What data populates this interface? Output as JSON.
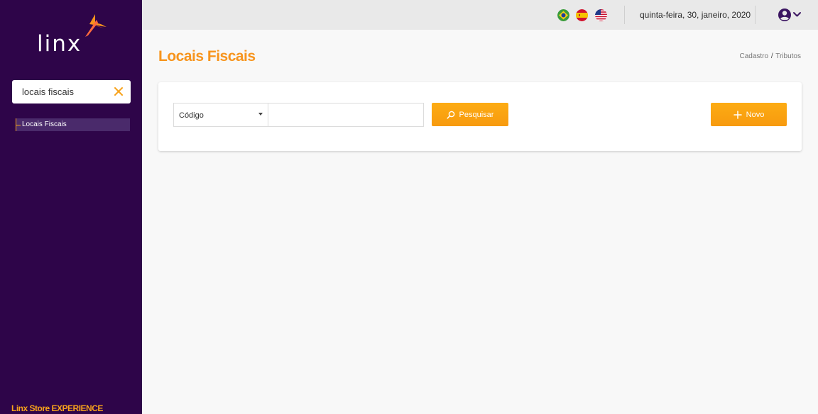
{
  "sidebar": {
    "logo_text": "linx",
    "search_value": "locais fiscais",
    "items": [
      {
        "label": "Locais Fiscais"
      }
    ],
    "footer": "Linx Store EXPERIENCE"
  },
  "topbar": {
    "flags": [
      "flag-brazil-icon",
      "flag-spain-icon",
      "flag-usa-icon"
    ],
    "date": "quinta-feira, 30, janeiro, 2020"
  },
  "page": {
    "title": "Locais Fiscais",
    "breadcrumb": {
      "parent": "Cadastro",
      "separator": "/",
      "current": "Tributos"
    }
  },
  "filter": {
    "select_value": "Código",
    "search_value": "",
    "search_button": "Pesquisar",
    "new_button": "Novo"
  },
  "colors": {
    "sidebar_bg": "#2e0549",
    "accent": "#f7941d",
    "button": "#fdac13",
    "topbar_bg": "#e9e9e9"
  }
}
